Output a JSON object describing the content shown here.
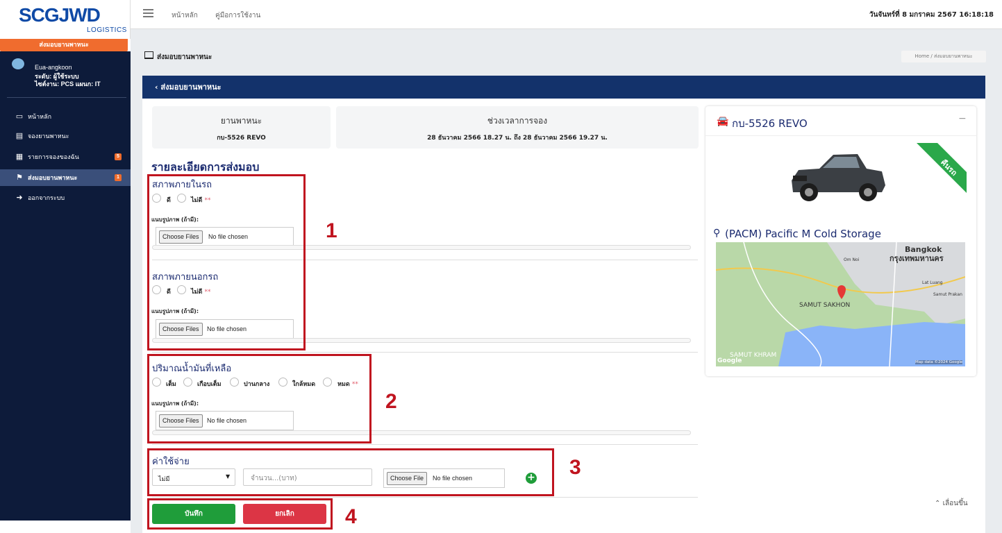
{
  "brand": {
    "logo": "SCGJWD",
    "sub": "LOGISTICS",
    "bar": "ส่งมอบยานพาหนะ"
  },
  "user": {
    "name": "Eua-angkoon",
    "level": "ระดับ: ผู้ใช้ระบบ",
    "site": "ไซต์งาน: PCS แผนก: IT"
  },
  "nav": {
    "items": [
      {
        "label": "หน้าหลัก"
      },
      {
        "label": "จองยานพาหนะ"
      },
      {
        "label": "รายการจองของฉัน",
        "badge": "5"
      },
      {
        "label": "ส่งมอบยานพาหนะ",
        "badge": "1"
      },
      {
        "label": "ออกจากระบบ"
      }
    ]
  },
  "topbar": {
    "home": "หน้าหลัก",
    "manual": "คู่มือการใช้งาน",
    "datetime": "วันจันทร์ที่ 8 มกราคม 2567 16:18:18"
  },
  "page": {
    "title": "ส่งมอบยานพาหนะ",
    "breadcrumb": "Home  /  ส่งมอบยานพาหนะ"
  },
  "card": {
    "header": "ส่งมอบยานพาหนะ"
  },
  "vehicle": {
    "label": "ยานพาหนะ",
    "value": "กบ-5526 REVO"
  },
  "booking": {
    "label": "ช่วงเวลาการจอง",
    "value": "28 ธันวาคม 2566 18.27 น. ถึง 28 ธันวาคม 2566 19.27 น."
  },
  "details": {
    "title": "รายละเอียดการส่งมอบ"
  },
  "interior": {
    "title": "สภาพภายในรถ",
    "good": "ดี",
    "bad": "ไม่ดี",
    "req": "**",
    "attach": "แนบรูปภาพ (ถ้ามี):",
    "file_btn": "Choose Files",
    "file_txt": "No file chosen"
  },
  "exterior": {
    "title": "สภาพภายนอกรถ",
    "good": "ดี",
    "bad": "ไม่ดี",
    "req": "**",
    "attach": "แนบรูปภาพ (ถ้ามี):",
    "file_btn": "Choose Files",
    "file_txt": "No file chosen"
  },
  "fuel": {
    "title": "ปริมาณน้ำมันที่เหลือ",
    "options": [
      "เต็ม",
      "เกือบเต็ม",
      "ปานกลาง",
      "ใกล้หมด",
      "หมด"
    ],
    "req": "**",
    "attach": "แนบรูปภาพ (ถ้ามี):",
    "file_btn": "Choose Files",
    "file_txt": "No file chosen"
  },
  "expense": {
    "title": "ค่าใช้จ่าย",
    "select": "ไม่มี",
    "amount_placeholder": "จำนวน...(บาท)",
    "file_btn": "Choose File",
    "file_txt": "No file chosen"
  },
  "buttons": {
    "save": "บันทึก",
    "cancel": "ยกเลิก"
  },
  "annotations": [
    "1",
    "2",
    "3",
    "4"
  ],
  "panel": {
    "plate": "กบ-5526 REVO",
    "ribbon": "คืนรถ",
    "location": "(PACM) Pacific M Cold Storage",
    "collapse": "−"
  },
  "map": {
    "bangkok_en": "Bangkok",
    "bangkok_th": "กรุงเทพมหานคร",
    "samut_sakhon": "SAMUT SAKHON",
    "samut_khram": "SAMUT KHRAM",
    "om_noi": "Om Noi",
    "lat_luang": "Lat Luang",
    "samut_prakan": "Samut Prakan",
    "credit": "Map data ©2024 Google",
    "google": "Google"
  },
  "scroll_top": "เลื่อนขึ้น",
  "colors": {
    "navy": "#13326b",
    "sidebar": "#0d1b3a",
    "orange": "#f06c2e",
    "save": "#1f9d3a",
    "cancel": "#dc3545",
    "annot": "#c0141f"
  }
}
